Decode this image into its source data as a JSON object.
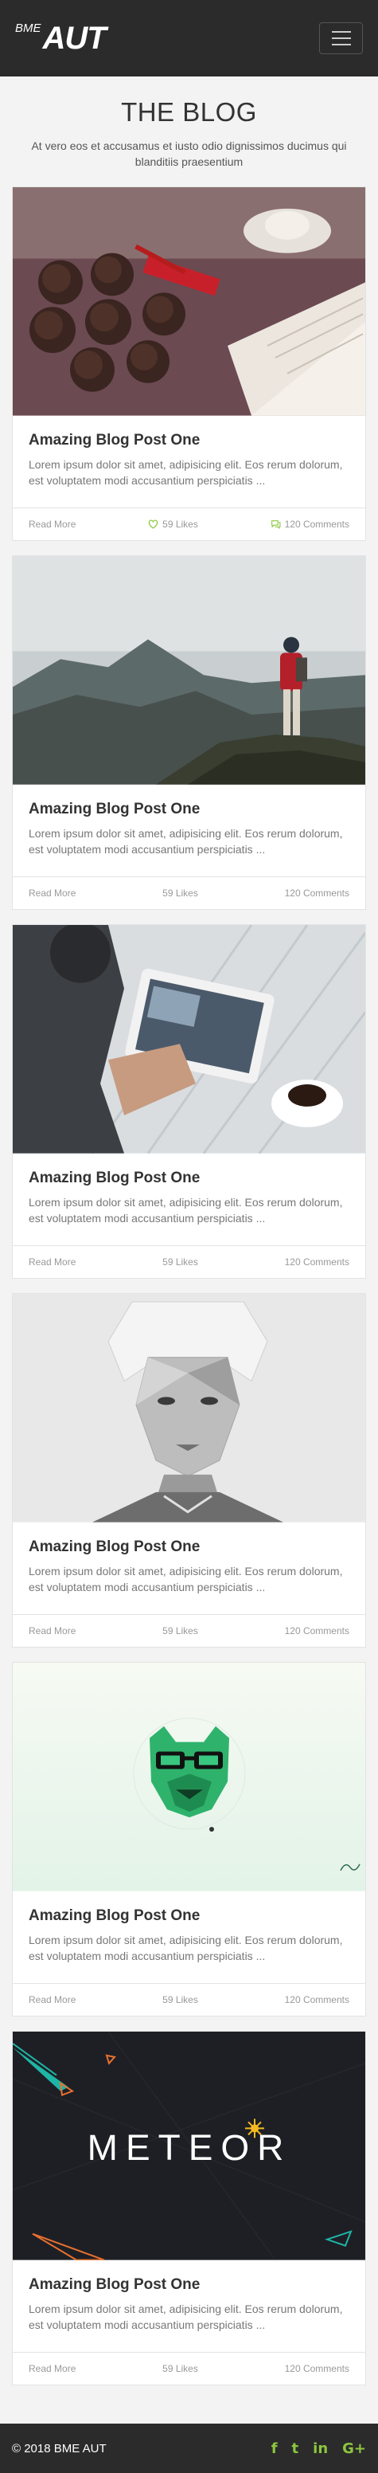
{
  "nav": {
    "logo_small": "BME",
    "logo_big": "AUT",
    "menu_icon": "hamburger-icon"
  },
  "hero": {
    "title": "THE BLOG",
    "subtitle": "At vero eos et accusamus et iusto odio dignissimos ducimus qui blanditiis praesentium"
  },
  "posts": [
    {
      "title": "Amazing Blog Post One",
      "text": "Lorem ipsum dolor sit amet, adipisicing elit. Eos rerum dolorum, est voluptatem modi accusantium perspiciatis ...",
      "read_more": "Read More",
      "likes": "59 Likes",
      "comments": "120 Comments",
      "icons": true
    },
    {
      "title": "Amazing Blog Post One",
      "text": "Lorem ipsum dolor sit amet, adipisicing elit. Eos rerum dolorum, est voluptatem modi accusantium perspiciatis ...",
      "read_more": "Read More",
      "likes": "59 Likes",
      "comments": "120 Comments",
      "icons": false
    },
    {
      "title": "Amazing Blog Post One",
      "text": "Lorem ipsum dolor sit amet, adipisicing elit. Eos rerum dolorum, est voluptatem modi accusantium perspiciatis ...",
      "read_more": "Read More",
      "likes": "59 Likes",
      "comments": "120 Comments",
      "icons": false
    },
    {
      "title": "Amazing Blog Post One",
      "text": "Lorem ipsum dolor sit amet, adipisicing elit. Eos rerum dolorum, est voluptatem modi accusantium perspiciatis ...",
      "read_more": "Read More",
      "likes": "59 Likes",
      "comments": "120 Comments",
      "icons": false
    },
    {
      "title": "Amazing Blog Post One",
      "text": "Lorem ipsum dolor sit amet, adipisicing elit. Eos rerum dolorum, est voluptatem modi accusantium perspiciatis ...",
      "read_more": "Read More",
      "likes": "59 Likes",
      "comments": "120 Comments",
      "icons": false
    },
    {
      "title": "Amazing Blog Post One",
      "text": "Lorem ipsum dolor sit amet, adipisicing elit. Eos rerum dolorum, est voluptatem modi accusantium perspiciatis ...",
      "read_more": "Read More",
      "likes": "59 Likes",
      "comments": "120 Comments",
      "icons": false
    }
  ],
  "thumb_text": {
    "meteor_logo": "METEOR"
  },
  "footer": {
    "copyright": "© 2018 BME AUT",
    "social": [
      {
        "icon": "facebook-icon",
        "glyph": "f"
      },
      {
        "icon": "twitter-icon",
        "glyph": "t"
      },
      {
        "icon": "linkedin-icon",
        "glyph": "in"
      },
      {
        "icon": "google-plus-icon",
        "glyph": "G+"
      }
    ]
  },
  "colors": {
    "navbar": "#2b2b2b",
    "background": "#f3f3f3",
    "accent_green": "#8cc63f"
  }
}
